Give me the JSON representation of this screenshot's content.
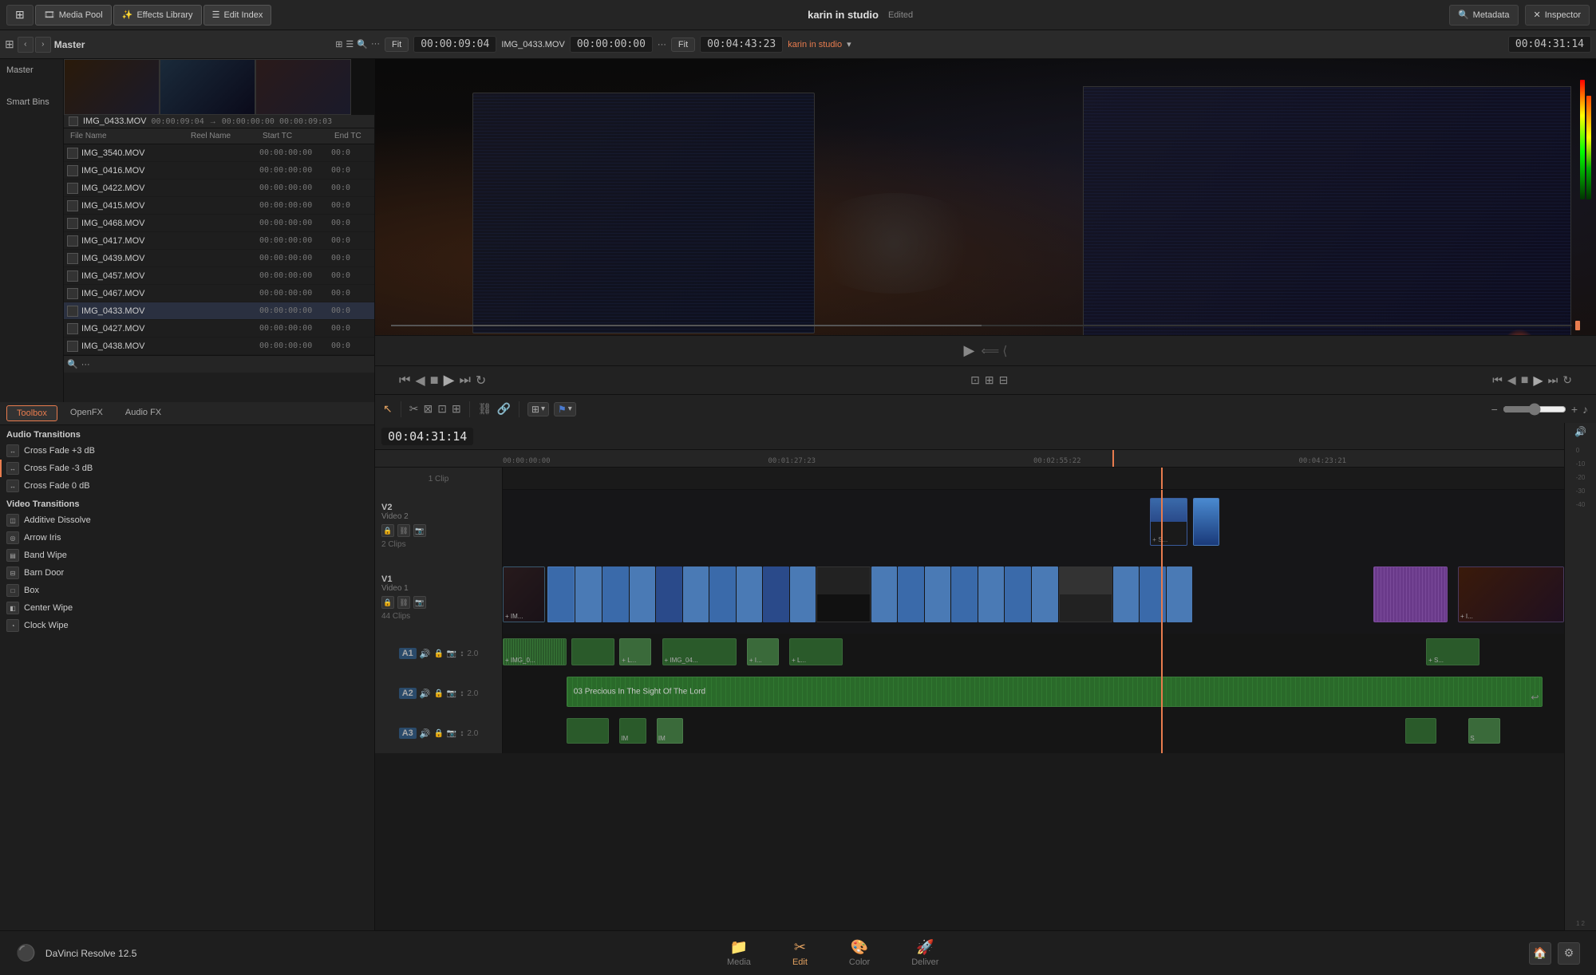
{
  "app": {
    "title": "DaVinci Resolve 12.5",
    "project_name": "karin in studio",
    "edited_label": "Edited"
  },
  "topbar": {
    "workspace_icon": "⊞",
    "media_pool_label": "Media Pool",
    "effects_library_label": "Effects Library",
    "edit_index_label": "Edit Index",
    "metadata_label": "Metadata",
    "inspector_label": "Inspector"
  },
  "secondbar": {
    "master_label": "Master",
    "fit_label": "Fit",
    "source_tc": "00:00:09:04",
    "source_clip": "IMG_0433.MOV",
    "source_timecode2": "00:00:00:00",
    "viewer_fit": "Fit",
    "viewer_tc": "00:04:43:23",
    "timeline_name": "karin in studio",
    "timeline_tc": "00:04:31:14"
  },
  "media_pool": {
    "section_label": "Master",
    "smart_bins_label": "Smart Bins",
    "preview_clip": "IMG_0433.MOV",
    "preview_tc1": "00:00:09:04",
    "preview_tc2": "00:00:00:00",
    "preview_tc3": "00:00:09:03",
    "col_filename": "File Name",
    "col_reel": "Reel Name",
    "col_start": "Start TC",
    "col_end": "End TC",
    "files": [
      {
        "name": "IMG_3540.MOV",
        "start": "00:00:00:00",
        "end": "00:0"
      },
      {
        "name": "IMG_0416.MOV",
        "start": "00:00:00:00",
        "end": "00:0"
      },
      {
        "name": "IMG_0422.MOV",
        "start": "00:00:00:00",
        "end": "00:0"
      },
      {
        "name": "IMG_0415.MOV",
        "start": "00:00:00:00",
        "end": "00:0"
      },
      {
        "name": "IMG_0468.MOV",
        "start": "00:00:00:00",
        "end": "00:0"
      },
      {
        "name": "IMG_0417.MOV",
        "start": "00:00:00:00",
        "end": "00:0"
      },
      {
        "name": "IMG_0439.MOV",
        "start": "00:00:00:00",
        "end": "00:0"
      },
      {
        "name": "IMG_0457.MOV",
        "start": "00:00:00:00",
        "end": "00:0"
      },
      {
        "name": "IMG_0467.MOV",
        "start": "00:00:00:00",
        "end": "00:0"
      },
      {
        "name": "IMG_0433.MOV",
        "start": "00:00:00:00",
        "end": "00:0",
        "selected": true
      },
      {
        "name": "IMG_0427.MOV",
        "start": "00:00:00:00",
        "end": "00:0"
      },
      {
        "name": "IMG_0438.MOV",
        "start": "00:00:00:00",
        "end": "00:0"
      }
    ]
  },
  "effects": {
    "tabs": [
      {
        "id": "toolbox",
        "label": "Toolbox",
        "active": true
      },
      {
        "id": "openfx",
        "label": "OpenFX",
        "active": false
      },
      {
        "id": "audiofx",
        "label": "Audio FX",
        "active": false
      }
    ],
    "sections": [
      {
        "title": "Audio Transitions",
        "items": [
          {
            "name": "Cross Fade +3 dB"
          },
          {
            "name": "Cross Fade -3 dB"
          },
          {
            "name": "Cross Fade 0 dB"
          }
        ]
      },
      {
        "title": "Video Transitions",
        "items": [
          {
            "name": "Additive Dissolve"
          },
          {
            "name": "Arrow Iris"
          },
          {
            "name": "Band Wipe"
          },
          {
            "name": "Barn Door"
          },
          {
            "name": "Box"
          },
          {
            "name": "Center Wipe"
          },
          {
            "name": "Clock Wipe"
          }
        ]
      }
    ]
  },
  "timeline": {
    "current_tc": "00:04:31:14",
    "ruler_marks": [
      "00:00:00:00",
      "00:01:27:23",
      "00:02:55:22",
      "00:04:23:21"
    ],
    "tracks": [
      {
        "id": "clip1",
        "label": "1 Clip",
        "type": "label"
      },
      {
        "id": "v2",
        "label": "Video 2",
        "sub": "2 Clips",
        "type": "video"
      },
      {
        "id": "v1",
        "label": "Video 1",
        "sub": "44 Clips",
        "type": "video"
      },
      {
        "id": "a1",
        "label": "A1",
        "sub": "2.0",
        "type": "audio"
      },
      {
        "id": "a2",
        "label": "A2",
        "sub": "2.0",
        "type": "audio"
      },
      {
        "id": "a3",
        "label": "A3",
        "sub": "2.0",
        "type": "audio"
      }
    ],
    "a2_clip_label": "03 Precious In The Sight Of The Lord"
  },
  "preview": {
    "playback_tc": "00:00:00:00",
    "playback_tc2": "00:04:31:14"
  },
  "bottom_nav": [
    {
      "id": "media",
      "label": "Media",
      "icon": "📁"
    },
    {
      "id": "edit",
      "label": "Edit",
      "icon": "✂",
      "active": true
    },
    {
      "id": "color",
      "label": "Color",
      "icon": "🎨"
    },
    {
      "id": "deliver",
      "label": "Deliver",
      "icon": "🚀"
    }
  ]
}
